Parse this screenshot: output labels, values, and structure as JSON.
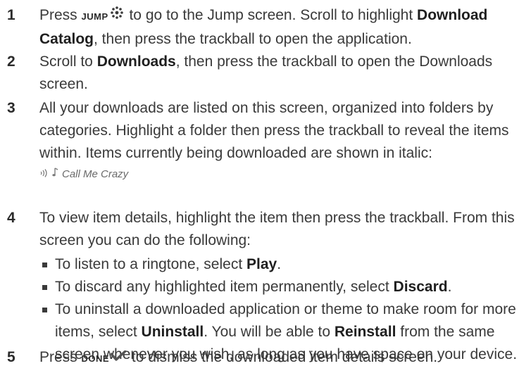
{
  "steps": [
    {
      "number": "1",
      "parts": {
        "a": "Press ",
        "key": "JUMP",
        "b": " to go to the Jump screen. Scroll to highlight ",
        "bold1": "Download Catalog",
        "c": ", then press the trackball to open the application."
      }
    },
    {
      "number": "2",
      "parts": {
        "a": "Scroll to ",
        "bold1": "Downloads",
        "b": ", then press the trackball to open the Downloads screen."
      }
    },
    {
      "number": "3",
      "text": "All your downloads are listed on this screen, organized into folders by categories. Highlight a folder then press the trackball to reveal the items within. Items currently being downloaded are shown in italic:",
      "example": "Call Me Crazy"
    },
    {
      "number": "4",
      "text": "To view item details, highlight the item then press the trackball. From this screen you can do the following:",
      "bullets": [
        {
          "a": "To listen to a ringtone, select ",
          "bold": "Play",
          "b": "."
        },
        {
          "a": "To discard any highlighted item permanently, select ",
          "bold": "Discard",
          "b": "."
        },
        {
          "a": "To uninstall a downloaded application or theme to make room for more items, select ",
          "bold": "Uninstall",
          "b": ". You will be able to ",
          "bold2": "Reinstall",
          "c": " from the same screen whenever you wish, as long as you have space on your device."
        }
      ]
    },
    {
      "number": "5",
      "parts": {
        "a": "Press ",
        "key": "DONE",
        "b": " to dismiss the downloaded item details screen."
      }
    }
  ],
  "icons": {
    "jump": "jump-key-icon",
    "done": "done-checkmark-icon",
    "downloading": "downloading-indicator-icon",
    "music": "music-note-icon"
  },
  "colors": {
    "text": "#3a3a3a",
    "done_icon": "#555555"
  }
}
